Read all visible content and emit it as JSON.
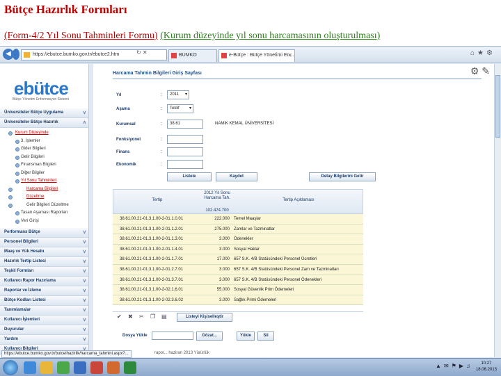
{
  "slide": {
    "title": "Bütçe Hazırlık Formları",
    "subtitle_a": "(Form-4/2 Yıl Sonu Tahminleri Formu)",
    "subtitle_b": "(Kurum düzeyinde yıl sonu harcamasının oluşturulması)"
  },
  "browser": {
    "url": "https://ebutce.bumko.gov.tr/ebutce2.htm",
    "tabs": [
      {
        "label": "BUMKO"
      },
      {
        "label": "e-Bütçe : Bütçe Yönetimi En..."
      }
    ]
  },
  "sidebar": {
    "logo": "ebütce",
    "logo_sub": "Bütçe Yönetim Enformasyon Sistemi",
    "menu_top": [
      {
        "label": "Üniversiteler Bütçe Uygulama"
      },
      {
        "label": "Üniversiteler Bütçe Hazırlık"
      }
    ],
    "sub_items": [
      {
        "label": "Kurum Düzeyinde",
        "cls": "red"
      },
      {
        "label": "3. İşlemler",
        "cls": "lvl2"
      },
      {
        "label": "Gider Bilgileri",
        "cls": "lvl2"
      },
      {
        "label": "Gelir Bilgileri",
        "cls": "lvl2"
      },
      {
        "label": "Finansman Bilgileri",
        "cls": "lvl2"
      },
      {
        "label": "Diğer Bilgiler",
        "cls": "lvl2"
      },
      {
        "label": "Yıl Sonu Tahminleri",
        "cls": "lvl2 red"
      },
      {
        "label": "Harcama Bilgileri",
        "cls": "lvl3 red"
      },
      {
        "label": "Düzeltme",
        "cls": "lvl3 red"
      },
      {
        "label": "Gelir Bilgileri Düzeltme",
        "cls": "lvl3"
      },
      {
        "label": "Tasarı Aşaması Raporları",
        "cls": "lvl2"
      },
      {
        "label": "Veri Girişi",
        "cls": "lvl2"
      }
    ],
    "menu_bottom": [
      {
        "label": "Performans Bütçe"
      },
      {
        "label": "Personel Bilgileri"
      },
      {
        "label": "Maaş ve Yük Hesabı"
      },
      {
        "label": "Hazırlık Tertip Listesi"
      },
      {
        "label": "Teşkil Formları"
      },
      {
        "label": "Kullanıcı Rapor Hazırlama"
      },
      {
        "label": "Raporlar ve İzleme"
      },
      {
        "label": "Bütçe Kodları Listesi"
      },
      {
        "label": "Tanımlamalar"
      },
      {
        "label": "Kullanıcı İşlemleri"
      },
      {
        "label": "Duyurular"
      },
      {
        "label": "Yardım"
      },
      {
        "label": "Kullanıcı Bilgileri"
      }
    ]
  },
  "content": {
    "header": "Harcama Tahmin Bilgileri Giriş Sayfası",
    "form": {
      "yil_label": "Yıl",
      "yil_value": "2011",
      "asama_label": "Aşama",
      "asama_value": "Teklif",
      "kurumsal_label": "Kurumsal",
      "kurumsal_value": "38.61",
      "kurum_adi": "NAMIK KEMAL ÜNİVERSİTESİ",
      "fonksiyonel_label": "Fonksiyonel",
      "finans_label": "Finans",
      "ekonomik_label": "Ekonomik"
    },
    "buttons": {
      "listele": "Listele",
      "kaydet": "Kaydet",
      "detay": "Detay Bilgilerini Getir"
    },
    "grid": {
      "col_tertip": "Tertip",
      "col_amount": "2012 Yıl Sonu Harcama Tah.",
      "total": "102.474.700",
      "col_aciklama": "Tertip Açıklaması",
      "rows": [
        {
          "tertip": "38.61.00.21-01.3.1.00-2-01.1.0.01",
          "amount": "222.000",
          "desc": "Temel Maaşlar"
        },
        {
          "tertip": "38.61.00.21-01.3.1.00-2-01.1.2.01",
          "amount": "275.000",
          "desc": "Zamlar ve Tazminatlar"
        },
        {
          "tertip": "38.61.00.21-01.3.1.00-2-01.1.3.01",
          "amount": "3.000",
          "desc": "Ödenekler"
        },
        {
          "tertip": "38.61.00.21-01.3.1.00-2-01.1.4.01",
          "amount": "3.000",
          "desc": "Sosyal Haklar"
        },
        {
          "tertip": "38.61.00.21-01.3.1.00-2-01.1.7.01",
          "amount": "17.000",
          "desc": "657 S.K. 4/B Statüsündeki Personel Ücretleri"
        },
        {
          "tertip": "38.61.00.21-01.3.1.00-2-01.2.7.01",
          "amount": "3.000",
          "desc": "657 S.K. 4/B Statüsündeki Personel Zam ve Tazminatları"
        },
        {
          "tertip": "38.61.00.21-01.3.1.00-2-01.3.7.01",
          "amount": "3.000",
          "desc": "657 S.K. 4/B Statüsündeki Personel Ödenekleri"
        },
        {
          "tertip": "38.61.00.21-01.3.1.00-2-02.1.6.01",
          "amount": "55.000",
          "desc": "Sosyal Güvenlik Prim Ödemeleri"
        },
        {
          "tertip": "38.61.00.21-01.3.1.00-2-02.3.6.02",
          "amount": "3.000",
          "desc": "Sağlık Primi Ödemeleri"
        }
      ]
    },
    "toolbar_btn": "Listeyi Kişiselleştir",
    "upload": {
      "label": "Dosya Yükle",
      "browse": "Gözat...",
      "upload_btn": "Yükle",
      "delete_btn": "Sil"
    },
    "footer_note": "rapor... haziran 2013 Yürürlük"
  },
  "status_url": "https://ebutce.bumko.gov.tr/butcelhazirlik/harcama_tahmini.aspx?...",
  "taskbar": {
    "clock_time": "10:27",
    "clock_date": "18.06.2013"
  }
}
